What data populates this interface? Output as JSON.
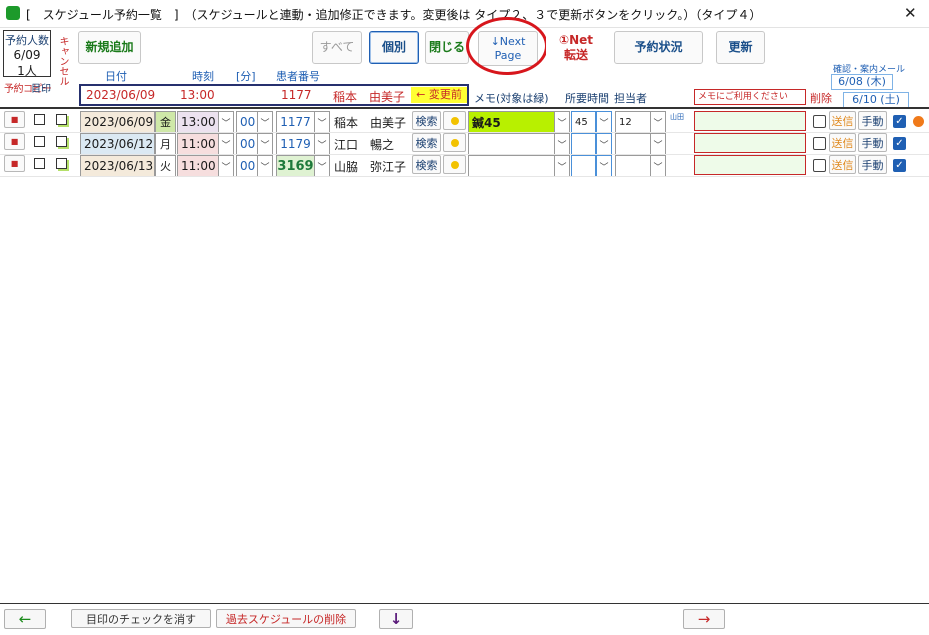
{
  "window": {
    "title": "[　スケジュール予約一覧　]　（スケジュールと連動・追加修正できます。変更後は タイプ２、３で更新ボタンをクリック。）（タイプ４）",
    "close_glyph": "✕"
  },
  "summary": {
    "label": "予約人数",
    "date": "6/09",
    "count": "1人"
  },
  "side_labels": {
    "cancel": "キャンセル",
    "copy": "予約コピー",
    "mark": "目印"
  },
  "toolbar": {
    "new": "新規追加",
    "all": "すべて",
    "individual": "個別",
    "close": "閉じる",
    "next_page_line1": "↓Next",
    "next_page_line2": "Page",
    "net_transfer_line1": "①Net",
    "net_transfer_line2": "転送",
    "reservation_status": "予約状況",
    "update": "更新"
  },
  "mail": {
    "label": "確認・案内メール",
    "date1": "6/08 (木)",
    "date2": "6/10 (土)"
  },
  "headers": {
    "date": "日付",
    "time": "時刻",
    "minutes": "[分]",
    "patient_no": "患者番号",
    "memo": "メモ(対象は緑)",
    "duration": "所要時間",
    "staff": "担当者",
    "delete": "削除"
  },
  "before_change": {
    "date": "2023/06/09",
    "time": "13:00",
    "patient_no": "1177",
    "name": "稲本　由美子",
    "badge": "← 変更前"
  },
  "memo_placeholder": "メモにご利用ください",
  "buttons": {
    "search": "検索",
    "send": "送信",
    "manual": "手動"
  },
  "rows": [
    {
      "date": "2023/06/09",
      "weekday": "金",
      "hour": "13:00",
      "minute": "00",
      "patient_no": "1177",
      "name": "稲本　由美子",
      "memo": "鍼45",
      "duration": "45",
      "staff": "12",
      "staff_tag": "山田"
    },
    {
      "date": "2023/06/12",
      "weekday": "月",
      "hour": "11:00",
      "minute": "00",
      "patient_no": "1179",
      "name": "江口　暢之",
      "memo": "",
      "duration": "",
      "staff": "",
      "staff_tag": ""
    },
    {
      "date": "2023/06/13",
      "weekday": "火",
      "hour": "11:00",
      "minute": "00",
      "patient_no": "3169",
      "name": "山脇　弥江子",
      "memo": "",
      "duration": "",
      "staff": "",
      "staff_tag": ""
    }
  ],
  "bottom": {
    "prev_arrow": "←",
    "clear_marks": "目印のチェックを消す",
    "delete_past": "過去スケジュールの削除",
    "down_arrow": "↓",
    "next_arrow": "→"
  },
  "colors": {
    "accent_blue": "#1f5fb3",
    "red": "#c62828",
    "green_memo": "#b8f000",
    "yellow_badge": "#ffff33",
    "circle": "#d7161c"
  }
}
